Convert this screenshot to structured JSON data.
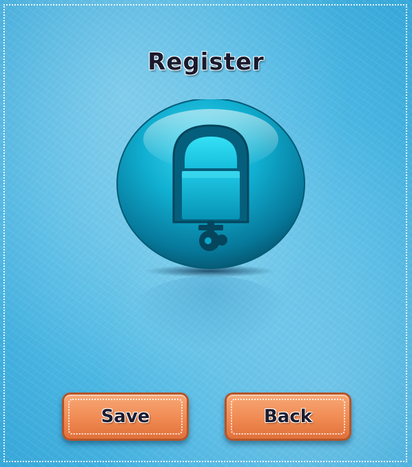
{
  "title": "Register",
  "icon": "padlock-icon",
  "buttons": {
    "save_label": "Save",
    "back_label": "Back"
  },
  "colors": {
    "background": "#4db8e4",
    "button": "#f08a52",
    "lock_body": "#0aa6c8",
    "title_text": "#1a1a2e"
  }
}
